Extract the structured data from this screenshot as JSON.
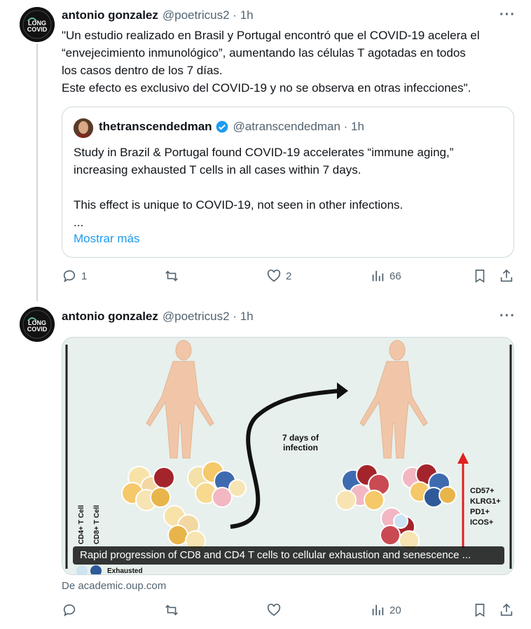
{
  "tweet1": {
    "author_name": "antonio gonzalez",
    "author_handle": "@poetricus2 · 1h",
    "avatar_text_top": "LONG",
    "avatar_text_bottom": "COVID",
    "more": "···",
    "text": "\"Un estudio realizado en Brasil y Portugal encontró que el COVID-19 acelera el\n“envejecimiento inmunológico”, aumentando las células T agotadas en todos\nlos casos dentro de los 7 días.\nEste efecto es exclusivo del COVID-19 y no se observa en otras infecciones\".",
    "quote": {
      "author_name": "thetranscendedman",
      "author_handle": "@atranscendedman · 1h",
      "text": "Study in Brazil & Portugal found COVID-19 accelerates “immune aging,”\nincreasing exhausted T cells in all cases within 7 days.\n\nThis effect is unique to COVID-19, not seen in other infections.\n...",
      "show_more": "Mostrar más"
    },
    "actions": {
      "replies": "1",
      "retweets": "",
      "likes": "2",
      "views": "66"
    }
  },
  "tweet2": {
    "author_name": "antonio gonzalez",
    "author_handle": "@poetricus2 · 1h",
    "avatar_text_top": "LONG",
    "avatar_text_bottom": "COVID",
    "more": "···",
    "image": {
      "arrow_label_1": "7 days of",
      "arrow_label_2": "infection",
      "markers": [
        "CD57+",
        "KLRG1+",
        "PD1+",
        "ICOS+"
      ],
      "axis_label_cd4": "CD4+ T Cell",
      "axis_label_cd8": "CD8+ T Cell",
      "legend_exhausted": "Exhausted",
      "caption": "Rapid progression of CD8 and CD4 T cells to cellular exhaustion and senescence ..."
    },
    "source": "De academic.oup.com",
    "actions": {
      "replies": "",
      "retweets": "",
      "likes": "",
      "views": "20"
    }
  }
}
